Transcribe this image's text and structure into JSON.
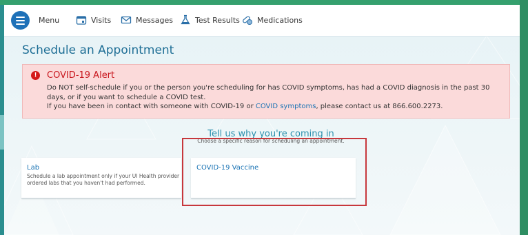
{
  "nav": {
    "menu_label": "Menu",
    "items": [
      {
        "label": "Visits",
        "icon": "calendar-icon"
      },
      {
        "label": "Messages",
        "icon": "envelope-icon"
      },
      {
        "label": "Test Results",
        "icon": "flask-icon"
      },
      {
        "label": "Medications",
        "icon": "pills-icon"
      }
    ]
  },
  "page": {
    "title": "Schedule an Appointment"
  },
  "alert": {
    "title": "COVID-19 Alert",
    "line1": "Do NOT self-schedule if you or the person you're scheduling for has COVID symptoms, has had a COVID diagnosis in the past 30 days, or if you want to schedule a COVID test.",
    "line2_before": "If you have been in contact with someone with COVID-19 or ",
    "line2_link": "COVID symptoms",
    "line2_after": ", please contact us at 866.600.2273."
  },
  "reason": {
    "heading": "Tell us why you're coming in",
    "subheading": "Choose a specific reason for scheduling an appointment."
  },
  "cards": [
    {
      "title": "Lab",
      "description": "Schedule a lab appointment only if your UI Health provider ordered labs that you haven't had performed."
    },
    {
      "title": "COVID-19 Vaccine",
      "description": ""
    }
  ],
  "colors": {
    "accent": "#1f6f96",
    "link": "#1a73b4",
    "alert_bg": "#fbdada",
    "alert_title": "#c8161d",
    "highlight_box": "#c7373c",
    "menu_button": "#1e71b8"
  }
}
